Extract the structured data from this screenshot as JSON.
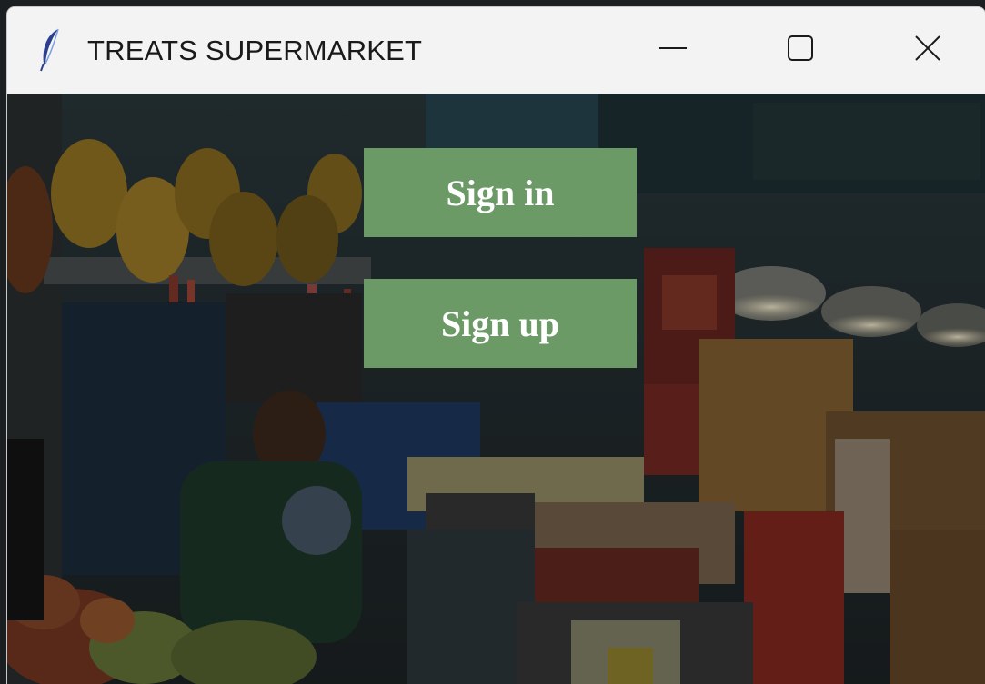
{
  "window": {
    "title": "TREATS SUPERMARKET",
    "icon": "feather-icon",
    "controls": {
      "minimize_icon": "minimize-icon",
      "maximize_icon": "maximize-icon",
      "close_icon": "close-icon"
    }
  },
  "main": {
    "background": "supermarket-market-stall-photo",
    "buttons": {
      "sign_in_label": "Sign in",
      "sign_up_label": "Sign up"
    },
    "button_color": "#6b9a66"
  }
}
